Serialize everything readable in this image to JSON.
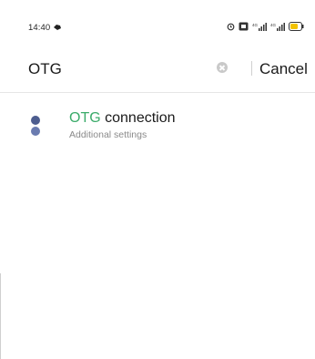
{
  "status_bar": {
    "time": "14:40",
    "icons": [
      "notification-icon",
      "alarm-icon",
      "nfc-icon",
      "signal-icon",
      "signal-icon",
      "battery-icon"
    ]
  },
  "search": {
    "value": "OTG",
    "placeholder": "",
    "cancel_label": "Cancel"
  },
  "results": [
    {
      "title_highlight": "OTG",
      "title_rest": " connection",
      "subtitle": "Additional settings",
      "icon": "otg-settings-icon"
    }
  ],
  "colors": {
    "highlight": "#3bab6a",
    "icon_top": "#4d5d8f",
    "icon_bottom": "#6a7bb0"
  }
}
